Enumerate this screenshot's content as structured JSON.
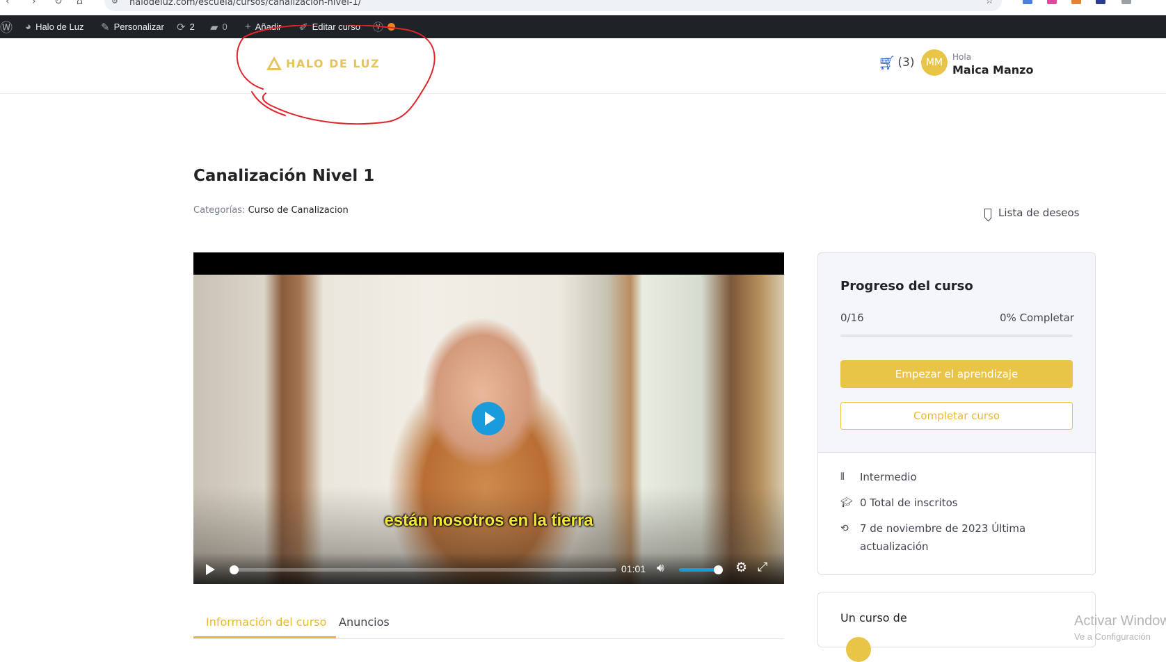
{
  "browser": {
    "url": "halodeluz.com/escuela/cursos/canalizacion-nivel-1/"
  },
  "adminbar": {
    "site_name": "Halo de Luz",
    "customize": "Personalizar",
    "updates_count": "2",
    "comments_count": "0",
    "add_new": "Añadir",
    "edit_course": "Editar curso"
  },
  "header": {
    "logo_text": "HALO DE  LUZ",
    "cart_count": "(3)",
    "avatar_initials": "MM",
    "greeting": "Hola",
    "user_name": "Maica Manzo"
  },
  "course": {
    "title": "Canalización Nivel 1",
    "categories_label": "Categorías:",
    "category": "Curso de Canalizacion",
    "wishlist": "Lista de deseos"
  },
  "video": {
    "subtitle": "están nosotros en la tierra",
    "time": "01:01",
    "seek_progress": 0.01,
    "volume_level": 0.85
  },
  "tabs": [
    {
      "label": "Información del curso",
      "active": true
    },
    {
      "label": "Anuncios",
      "active": false
    }
  ],
  "progress": {
    "title": "Progreso del curso",
    "count": "0/16",
    "percent_label": "0% Completar",
    "percent_value": 0,
    "start_button": "Empezar el aprendizaje",
    "complete_button": "Completar curso"
  },
  "meta": {
    "level": "Intermedio",
    "enrolled": "0 Total de inscritos",
    "updated_line1": "7 de noviembre de 2023 Última",
    "updated_line2": "actualización"
  },
  "author": {
    "title": "Un curso de"
  },
  "watermark": {
    "line1": "Activar Windows",
    "line2": "Ve a Configuración"
  },
  "colors": {
    "accent": "#e9c547",
    "adminbar": "#1d2327",
    "player_blue": "#1a9bdc",
    "annotation": "#e0242a"
  }
}
